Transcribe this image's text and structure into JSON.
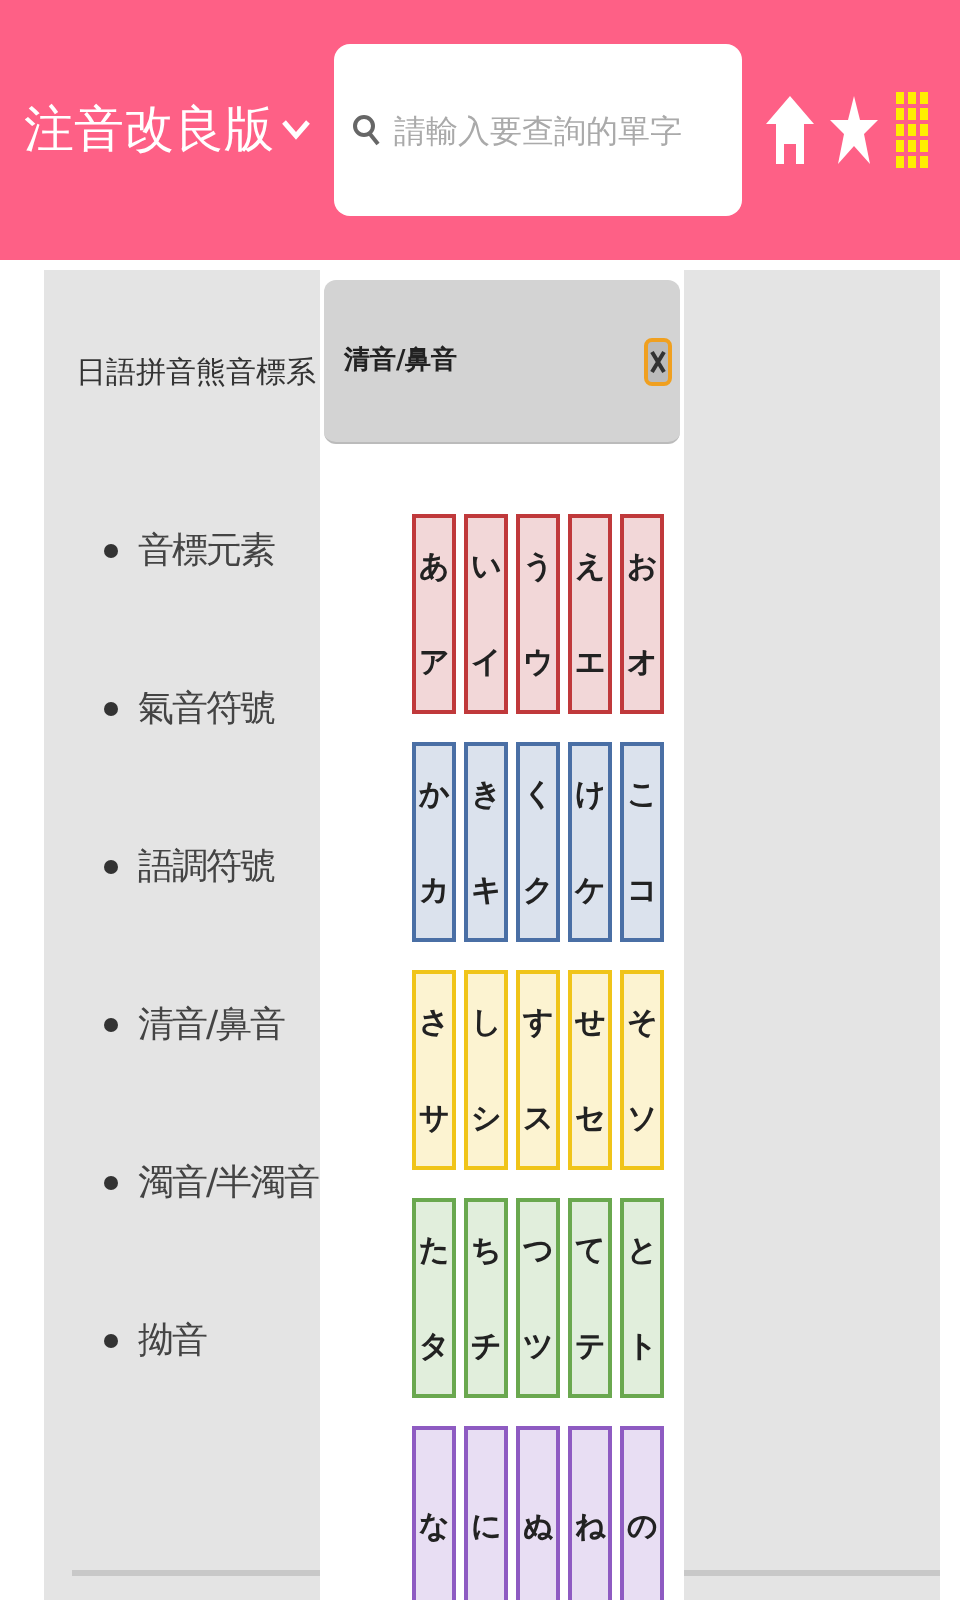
{
  "header": {
    "title": "注音改良版",
    "search": {
      "placeholder": "請輸入要查詢的單字"
    }
  },
  "sidebar": {
    "heading": "日語拼音熊音標系",
    "items": [
      "音標元素",
      "氣音符號",
      "語調符號",
      "清音/鼻音",
      "濁音/半濁音",
      "拗音"
    ]
  },
  "popup": {
    "title": "清音/鼻音",
    "rows": [
      {
        "color": "#c0393b",
        "tiles": [
          [
            "あ",
            "ア"
          ],
          [
            "い",
            "イ"
          ],
          [
            "う",
            "ウ"
          ],
          [
            "え",
            "エ"
          ],
          [
            "お",
            "オ"
          ]
        ]
      },
      {
        "color": "#4a6fa5",
        "tiles": [
          [
            "か",
            "カ"
          ],
          [
            "き",
            "キ"
          ],
          [
            "く",
            "ク"
          ],
          [
            "け",
            "ケ"
          ],
          [
            "こ",
            "コ"
          ]
        ]
      },
      {
        "color": "#f0c419",
        "tiles": [
          [
            "さ",
            "サ"
          ],
          [
            "し",
            "シ"
          ],
          [
            "す",
            "ス"
          ],
          [
            "せ",
            "セ"
          ],
          [
            "そ",
            "ソ"
          ]
        ]
      },
      {
        "color": "#6aa84f",
        "tiles": [
          [
            "た",
            "タ"
          ],
          [
            "ち",
            "チ"
          ],
          [
            "つ",
            "ツ"
          ],
          [
            "て",
            "テ"
          ],
          [
            "と",
            "ト"
          ]
        ]
      },
      {
        "color": "#8e5bc2",
        "tiles": [
          [
            "な"
          ],
          [
            "に"
          ],
          [
            "ぬ"
          ],
          [
            "ね"
          ],
          [
            "の"
          ]
        ]
      }
    ]
  }
}
